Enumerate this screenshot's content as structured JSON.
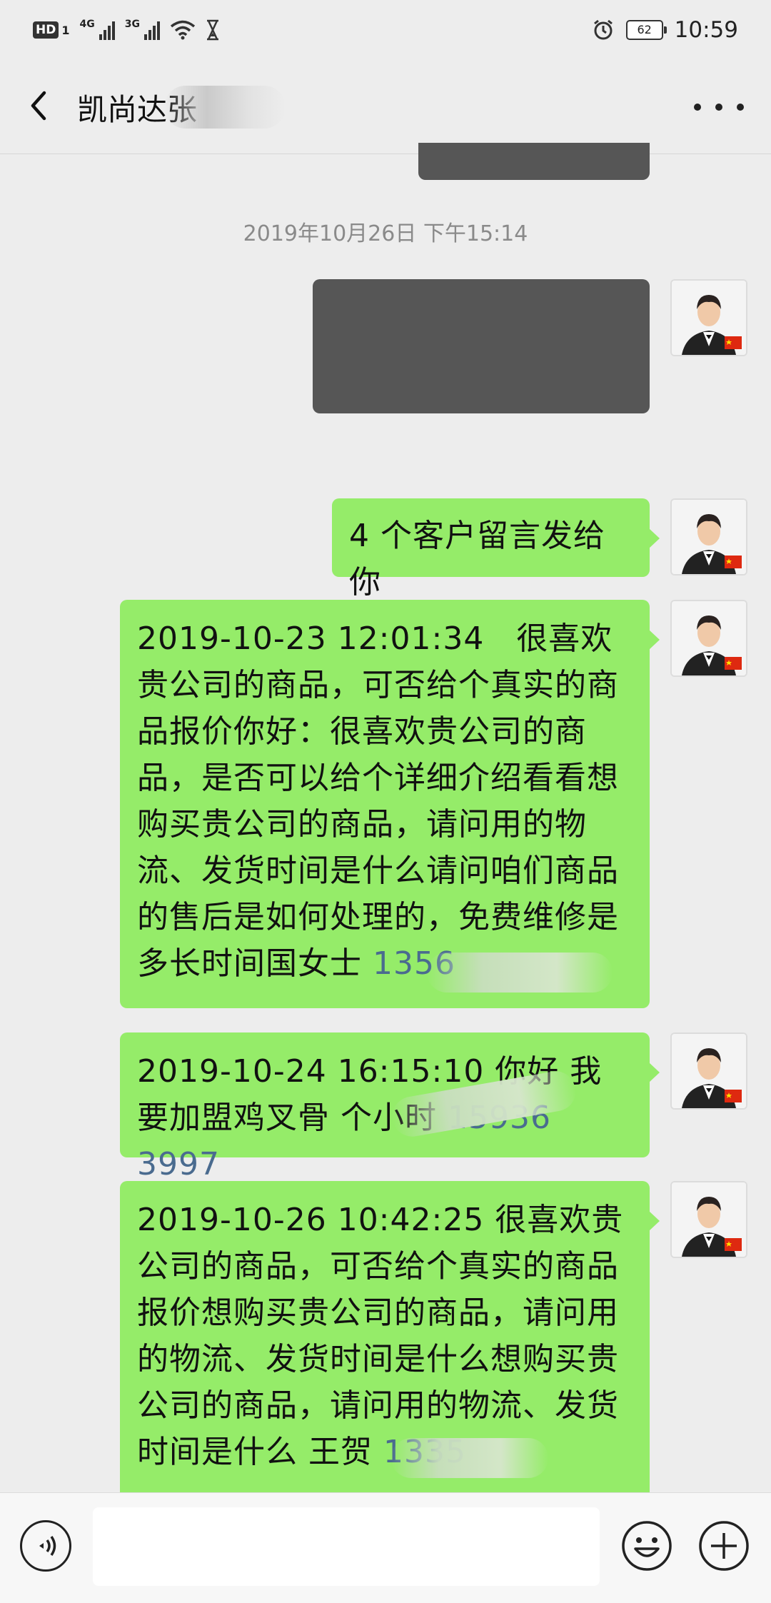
{
  "status_bar": {
    "hd": "HD",
    "sim1": "1",
    "net1": "4G",
    "net2": "3G",
    "battery": "62",
    "time": "10:59"
  },
  "header": {
    "title": "凯尚达张",
    "title_obscured": "…",
    "back_icon": "chevron-left-icon",
    "more_icon": "more-icon"
  },
  "chat": {
    "timestamp": "2019年10月26日 下午15:14",
    "messages": [
      {
        "text": "4 个客户留言发给你",
        "phone": ""
      },
      {
        "text": "2019-10-23 12:01:34　很喜欢贵公司的商品，可否给个真实的商品报价你好：很喜欢贵公司的商品，是否可以给个详细介绍看看想购买贵公司的商品，请问用的物流、发货时间是什么请问咱们商品的售后是如何处理的，免费维修是多长时间国女士 ",
        "phone": "1356"
      },
      {
        "text": "2019-10-24 16:15:10 你好 我要加盟鸡叉骨 个小时 ",
        "phone": "15936 3997"
      },
      {
        "text": "2019-10-26 10:42:25 很喜欢贵公司的商品，可否给个真实的商品报价想购买贵公司的商品，请问用的物流、发货时间是什么想购买贵公司的商品，请问用的物流、发货时间是什么 王贺 ",
        "phone": "1335"
      }
    ]
  },
  "input_bar": {
    "voice_icon": "voice-icon",
    "emoji_icon": "emoji-icon",
    "plus_icon": "plus-icon",
    "text_value": ""
  },
  "colors": {
    "background": "#ededed",
    "bubble_green": "#95ec69",
    "phone_link": "#4a6b8f",
    "timestamp_gray": "#8a8a8a"
  }
}
